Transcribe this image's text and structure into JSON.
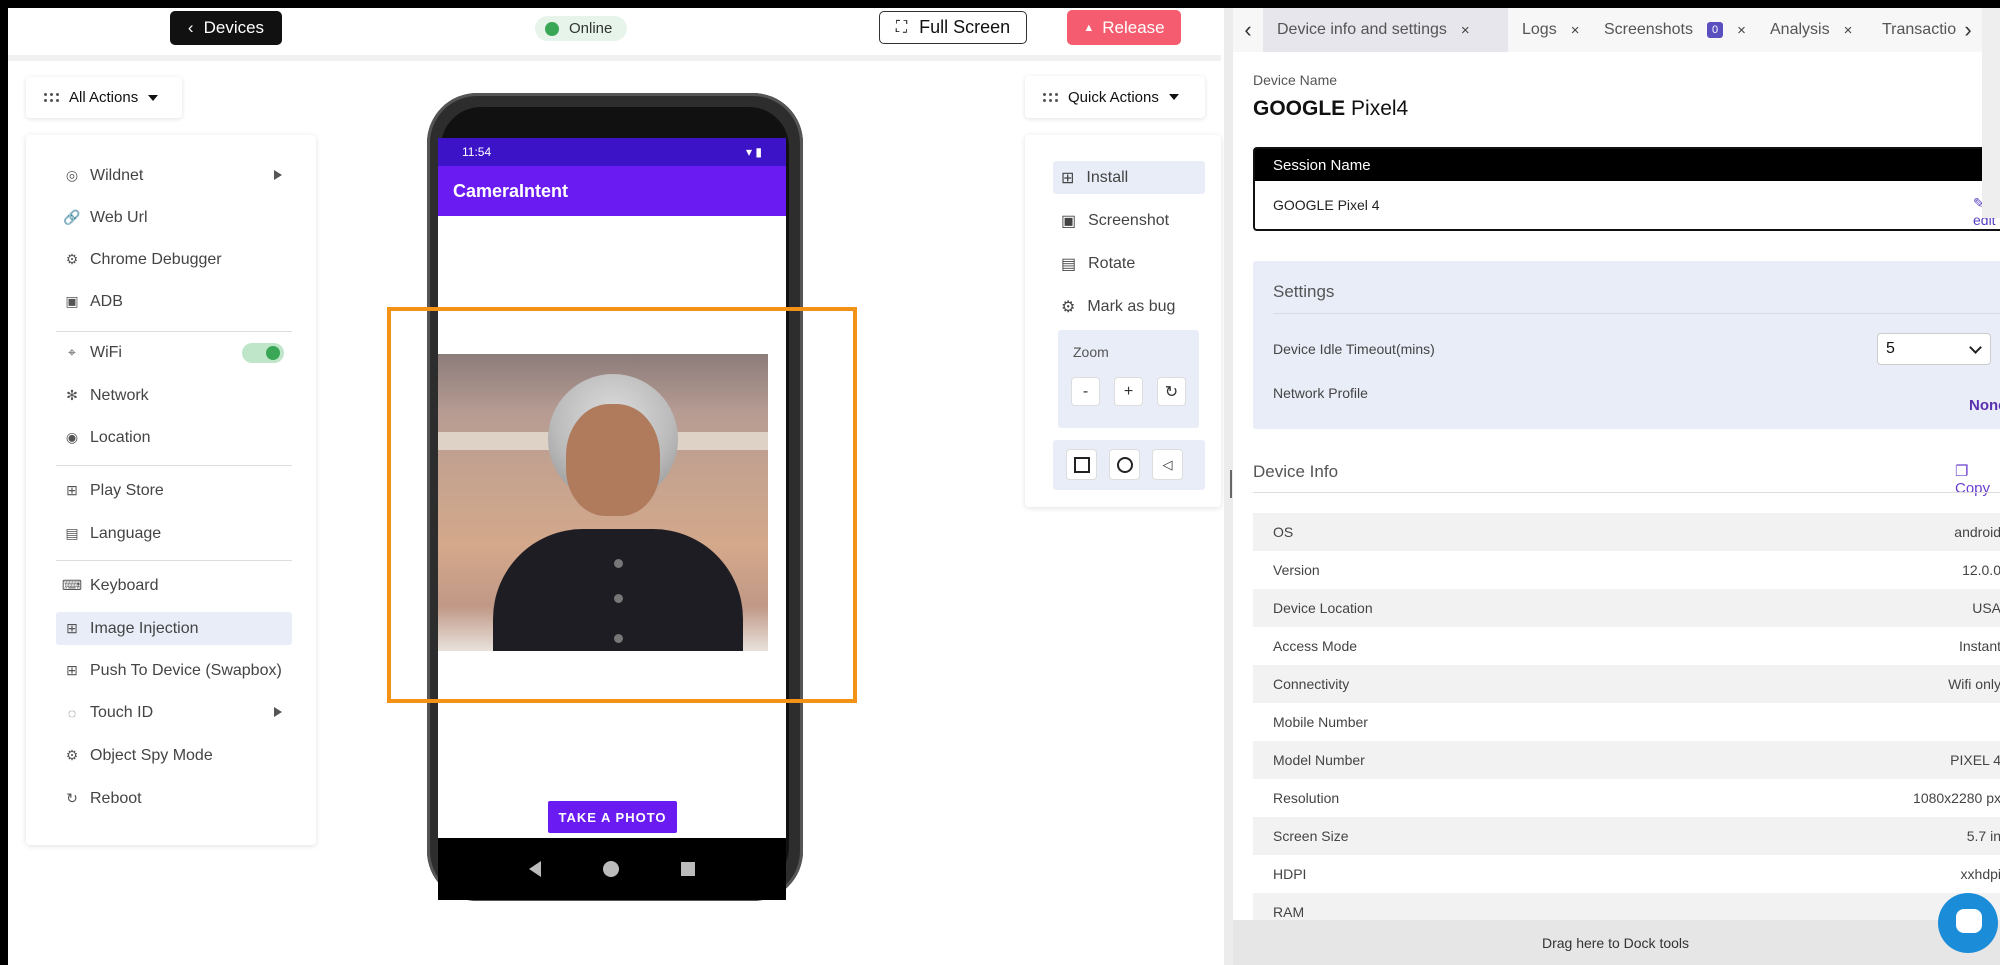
{
  "topbar": {
    "devices_label": "Devices",
    "status_label": "Online",
    "fullscreen_label": "Full Screen",
    "release_label": "Release"
  },
  "all_actions": {
    "title": "All Actions",
    "items": [
      {
        "label": "Wildnet",
        "icon": "wildnet-icon"
      },
      {
        "label": "Web Url",
        "icon": "link-icon"
      },
      {
        "label": "Chrome Debugger",
        "icon": "bug-icon"
      },
      {
        "label": "ADB",
        "icon": "adb-icon"
      },
      {
        "label": "WiFi",
        "icon": "wifi-icon"
      },
      {
        "label": "Network",
        "icon": "network-icon"
      },
      {
        "label": "Location",
        "icon": "location-icon"
      },
      {
        "label": "Play Store",
        "icon": "grid-icon"
      },
      {
        "label": "Language",
        "icon": "language-icon"
      },
      {
        "label": "Keyboard",
        "icon": "keyboard-icon"
      },
      {
        "label": "Image Injection",
        "icon": "image-injection-icon"
      },
      {
        "label": "Push To Device (Swapbox)",
        "icon": "push-icon"
      },
      {
        "label": "Touch ID",
        "icon": "fingerprint-icon"
      },
      {
        "label": "Object Spy Mode",
        "icon": "spy-icon"
      },
      {
        "label": "Reboot",
        "icon": "reboot-icon"
      }
    ]
  },
  "phone": {
    "time": "11:54",
    "app_title": "CameraIntent",
    "take_photo_label": "TAKE A PHOTO"
  },
  "quick_actions": {
    "title": "Quick Actions",
    "items": [
      {
        "label": "Install",
        "icon": "install-icon"
      },
      {
        "label": "Screenshot",
        "icon": "screenshot-icon"
      },
      {
        "label": "Rotate",
        "icon": "rotate-icon"
      },
      {
        "label": "Mark as bug",
        "icon": "bug-icon"
      }
    ],
    "zoom_label": "Zoom",
    "zoom_minus": "-",
    "zoom_plus": "+"
  },
  "right": {
    "tabs": [
      {
        "label": "Device info and settings"
      },
      {
        "label": "Logs"
      },
      {
        "label": "Screenshots",
        "badge": "0"
      },
      {
        "label": "Analysis"
      },
      {
        "label": "Transactio"
      }
    ],
    "device_name_label": "Device Name",
    "device_brand": "GOOGLE",
    "device_model": "Pixel4",
    "session_name_label": "Session Name",
    "session_name_value": "GOOGLE Pixel 4",
    "edit_label": "edit",
    "settings_title": "Settings",
    "idle_timeout_label": "Device Idle Timeout(mins)",
    "idle_timeout_value": "5",
    "network_profile_label": "Network Profile",
    "network_profile_value": "None",
    "device_info_title": "Device Info",
    "copy_label": "Copy",
    "info": [
      {
        "key": "OS",
        "value": "android"
      },
      {
        "key": "Version",
        "value": "12.0.0"
      },
      {
        "key": "Device Location",
        "value": "USA"
      },
      {
        "key": "Access Mode",
        "value": "Instant"
      },
      {
        "key": "Connectivity",
        "value": "Wifi only"
      },
      {
        "key": "Mobile Number",
        "value": ""
      },
      {
        "key": "Model Number",
        "value": "PIXEL 4"
      },
      {
        "key": "Resolution",
        "value": "1080x2280 px"
      },
      {
        "key": "Screen Size",
        "value": "5.7 in"
      },
      {
        "key": "HDPI",
        "value": "xxhdpi"
      },
      {
        "key": "RAM",
        "value": ""
      }
    ],
    "dock_label": "Drag here to Dock tools"
  }
}
